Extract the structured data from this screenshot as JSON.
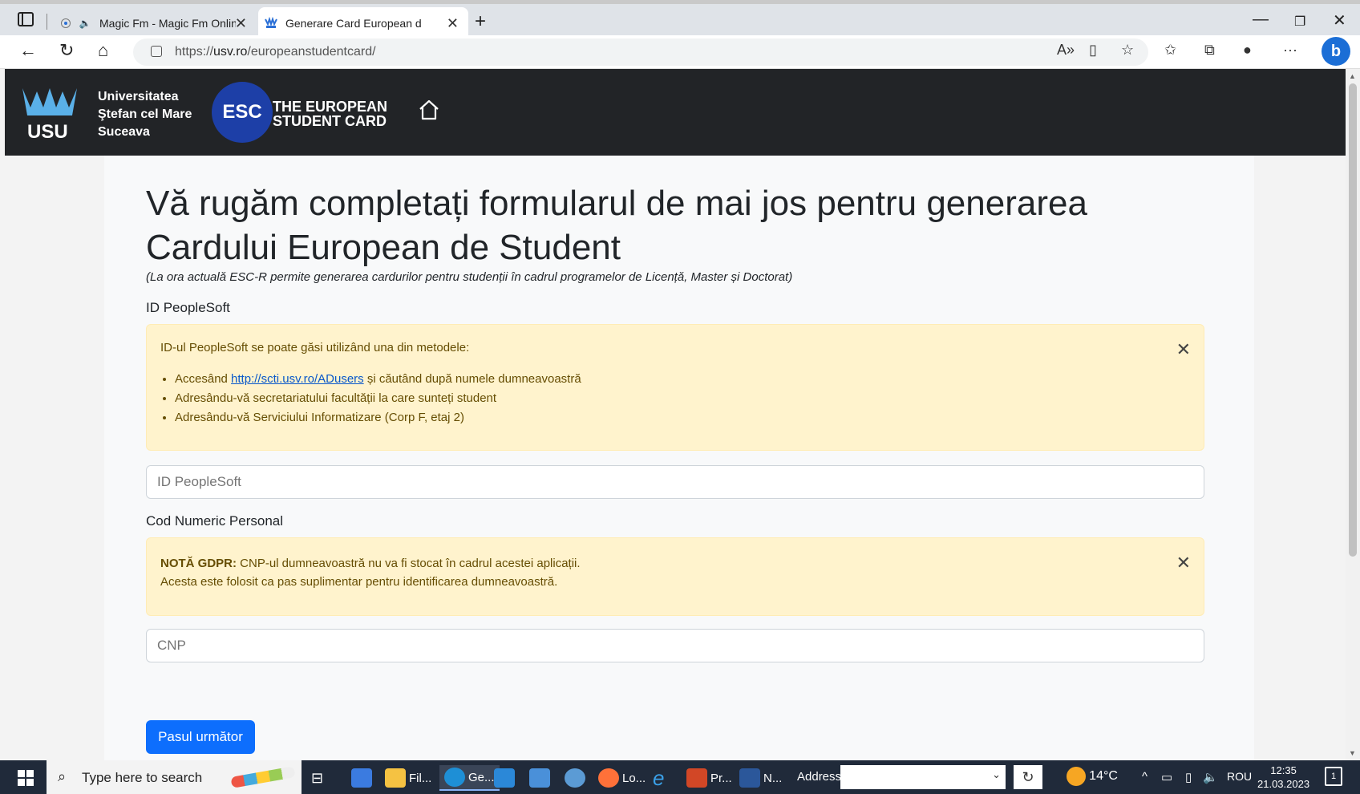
{
  "browser": {
    "tabs": [
      {
        "title": "Magic Fm - Magic Fm Online",
        "audio_icon": "speaker-icon",
        "active": false
      },
      {
        "title": "Generare Card European de Student",
        "active": true
      }
    ],
    "url_prefix": "https://",
    "url_host": "usv.ro",
    "url_path": "/europeanstudentcard/"
  },
  "site": {
    "university_line1": "Universitatea",
    "university_line2": "Ştefan cel Mare",
    "university_line3": "Suceava",
    "usv_abbr": "USU",
    "esc_abbr": "ESC",
    "esc_line1": "THE EUROPEAN",
    "esc_line2": "STUDENT CARD"
  },
  "form": {
    "title": "Vă rugăm completați formularul de mai jos pentru generarea Cardului European de Student",
    "subtitle": "(La ora actuală ESC-R permite generarea cardurilor pentru studenții în cadrul programelor de Licență, Master și Doctorat)",
    "peoplesoft_label": "ID PeopleSoft",
    "peoplesoft_alert_intro": "ID-ul PeopleSoft se poate găsi utilizând una din metodele:",
    "peoplesoft_methods": {
      "m1_prefix": "Accesând ",
      "m1_link": "http://scti.usv.ro/ADusers",
      "m1_suffix": " și căutând după numele dumneavoastră",
      "m2": "Adresându-vă secretariatului facultății la care sunteți student",
      "m3": "Adresându-vă Serviciului Informatizare (Corp F, etaj 2)"
    },
    "peoplesoft_placeholder": "ID PeopleSoft",
    "cnp_label": "Cod Numeric Personal",
    "gdpr_bold": "NOTĂ GDPR:",
    "gdpr_line1": " CNP-ul dumneavoastră nu va fi stocat în cadrul acestei aplicații.",
    "gdpr_line2": "Acesta este folosit ca pas suplimentar pentru identificarea dumneavoastră.",
    "cnp_placeholder": "CNP",
    "next_button": "Pasul următor"
  },
  "taskbar": {
    "search_placeholder": "Type here to search",
    "items": [
      {
        "label": "Fil...",
        "icon": "file-explorer-icon"
      },
      {
        "label": "Ge...",
        "icon": "edge-icon"
      },
      {
        "label": "Lo...",
        "icon": "firefox-icon"
      },
      {
        "label": "Pr...",
        "icon": "powerpoint-icon"
      },
      {
        "label": "N...",
        "icon": "word-icon"
      }
    ],
    "address_label": "Address",
    "temperature": "14°C",
    "language": "ROU",
    "time": "12:35",
    "date": "21.03.2023",
    "notification_count": "1"
  },
  "colors": {
    "header_bg": "#222427",
    "alert_bg": "#fff3cd",
    "primary": "#0d6efd",
    "esc_blue": "#1d3fa7"
  }
}
